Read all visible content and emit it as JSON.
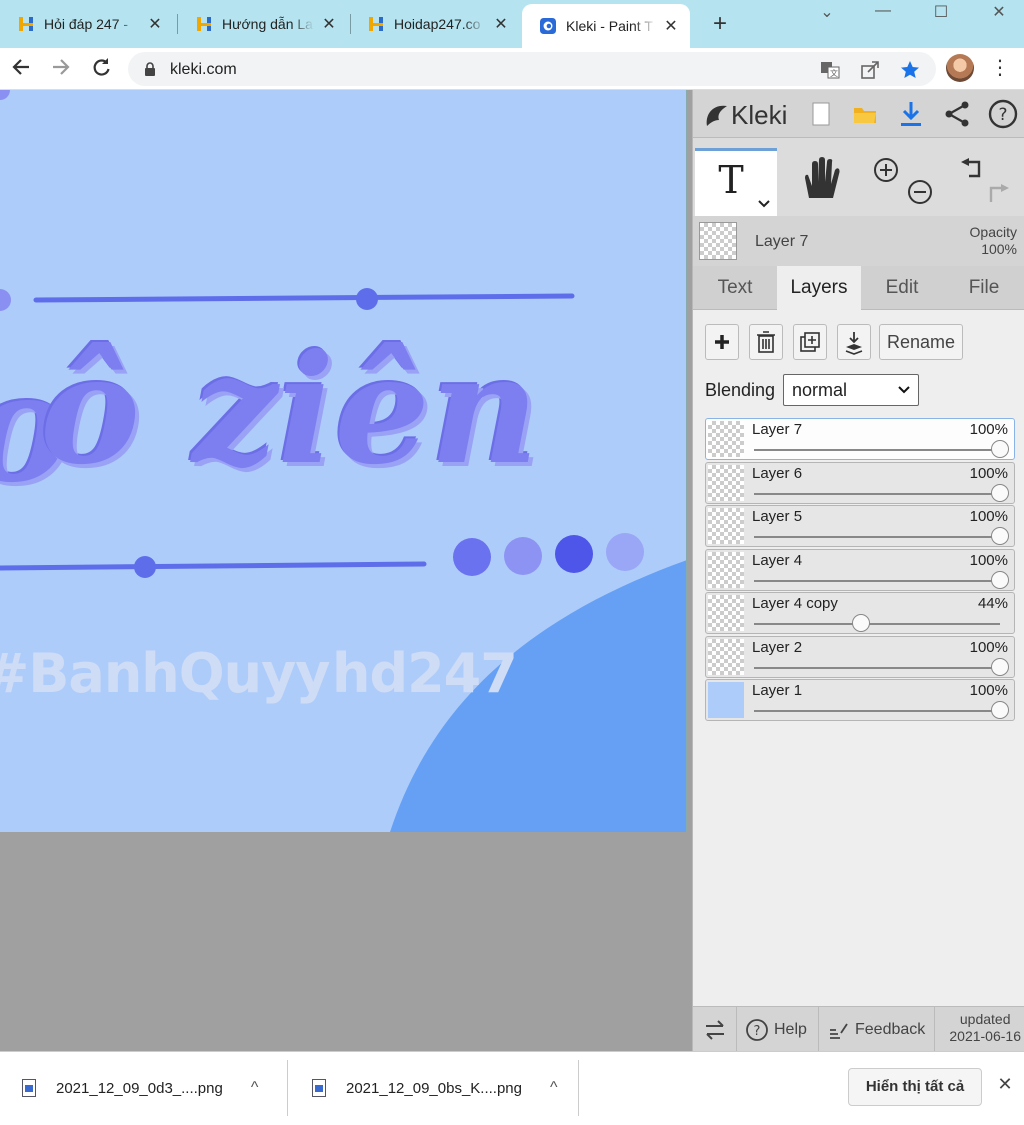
{
  "browser": {
    "tabs": [
      {
        "title": "Hỏi đáp 247 -",
        "icon": "hoidap-favicon"
      },
      {
        "title": "Hướng dẫn La",
        "icon": "hoidap-favicon"
      },
      {
        "title": "Hoidap247.co",
        "icon": "hoidap-favicon"
      },
      {
        "title": "Kleki - Paint T",
        "icon": "kleki-favicon",
        "active": true
      }
    ],
    "close_glyph": "✕",
    "new_tab_glyph": "+",
    "url": "kleki.com",
    "window_controls": {
      "dropdown": "⌄",
      "minimize": "—",
      "maximize": "☐",
      "close": "✕"
    }
  },
  "canvas": {
    "watermark_left": "#BanhQuyy",
    "watermark_right": "hd247",
    "art_text": "ô ziên",
    "art_text_partial": "o",
    "dot_colors": [
      "#6a72f0",
      "#8d93f3",
      "#4d56e8",
      "#9aa6f6"
    ],
    "canvas_color": "#aeccfa",
    "accent_blob_color": "#66a0f4",
    "line_color": "#5e6eea"
  },
  "panel": {
    "brand": "Kleki",
    "current_layer": "Layer 7",
    "opacity_label": "Opacity",
    "opacity_value": "100%",
    "tabs": [
      "Text",
      "Layers",
      "Edit",
      "File"
    ],
    "active_tab": "Layers",
    "rename_label": "Rename",
    "blending_label": "Blending",
    "blending_value": "normal",
    "layers": [
      {
        "name": "Layer 7",
        "opacity": "100%",
        "opacity_fraction": 1.0,
        "selected": true
      },
      {
        "name": "Layer 6",
        "opacity": "100%",
        "opacity_fraction": 1.0
      },
      {
        "name": "Layer 5",
        "opacity": "100%",
        "opacity_fraction": 1.0
      },
      {
        "name": "Layer 4",
        "opacity": "100%",
        "opacity_fraction": 1.0
      },
      {
        "name": "Layer 4 copy",
        "opacity": "44%",
        "opacity_fraction": 0.44
      },
      {
        "name": "Layer 2",
        "opacity": "100%",
        "opacity_fraction": 1.0
      },
      {
        "name": "Layer 1",
        "opacity": "100%",
        "opacity_fraction": 1.0
      }
    ],
    "footer": {
      "help": "Help",
      "feedback": "Feedback",
      "updated_label": "updated",
      "updated_date": "2021-06-16"
    }
  },
  "downloads": {
    "items": [
      "2021_12_09_0d3_....png",
      "2021_12_09_0bs_K....png"
    ],
    "chevron": "^",
    "show_all": "Hiển thị tất cả",
    "close_glyph": "✕"
  }
}
